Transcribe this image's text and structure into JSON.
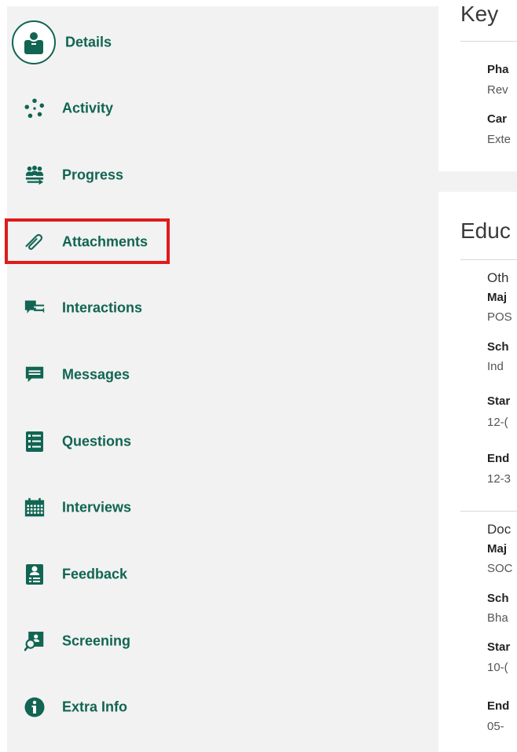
{
  "nav": {
    "items": [
      {
        "label": "Details",
        "icon": "person-icon"
      },
      {
        "label": "Activity",
        "icon": "activity-icon"
      },
      {
        "label": "Progress",
        "icon": "progress-icon"
      },
      {
        "label": "Attachments",
        "icon": "paperclip-icon"
      },
      {
        "label": "Interactions",
        "icon": "interactions-icon"
      },
      {
        "label": "Messages",
        "icon": "message-icon"
      },
      {
        "label": "Questions",
        "icon": "checklist-icon"
      },
      {
        "label": "Interviews",
        "icon": "calendar-icon"
      },
      {
        "label": "Feedback",
        "icon": "feedback-icon"
      },
      {
        "label": "Screening",
        "icon": "screening-icon"
      },
      {
        "label": "Extra Info",
        "icon": "info-icon"
      }
    ],
    "highlighted": "Attachments"
  },
  "key_section": {
    "title": "Key",
    "fields": [
      {
        "label": "Pha",
        "value": "Rev"
      },
      {
        "label": "Car",
        "value": "Exte"
      }
    ]
  },
  "education_section": {
    "title": "Educ",
    "entries": [
      {
        "title": "Oth",
        "fields": [
          {
            "label": "Maj",
            "value": "POS"
          },
          {
            "label": "Sch",
            "value": "Ind"
          },
          {
            "label": "Star",
            "value": "12-("
          },
          {
            "label": "End",
            "value": "12-3"
          }
        ]
      },
      {
        "title": "Doc",
        "fields": [
          {
            "label": "Maj",
            "value": "SOC"
          },
          {
            "label": "Sch",
            "value": "Bha"
          },
          {
            "label": "Star",
            "value": "10-("
          },
          {
            "label": "End",
            "value": "05-"
          }
        ]
      }
    ]
  },
  "colors": {
    "accent": "#116552",
    "highlight": "#e11b1b",
    "sidebar_bg": "#f2f2f2"
  }
}
